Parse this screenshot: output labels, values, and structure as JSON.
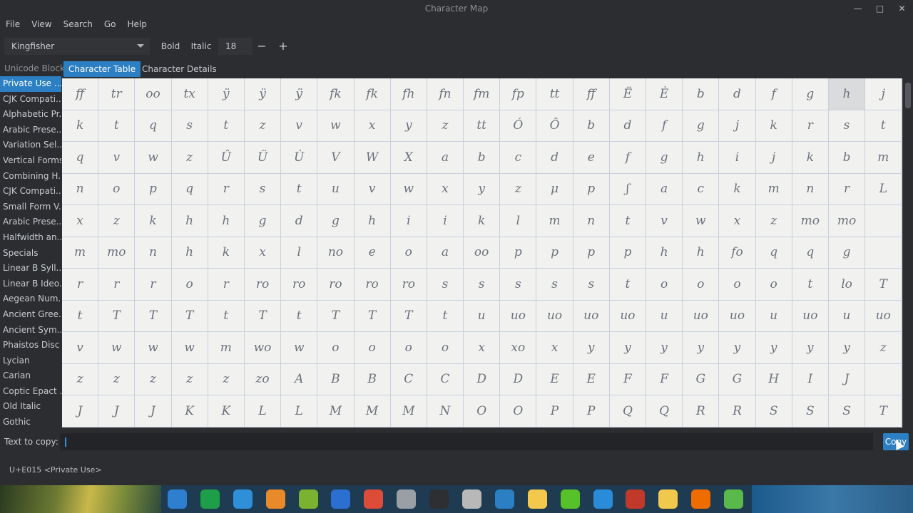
{
  "window": {
    "title": "Character Map"
  },
  "menu": [
    "File",
    "View",
    "Search",
    "Go",
    "Help"
  ],
  "toolbar": {
    "font": "Kingfisher",
    "bold": "Bold",
    "italic": "Italic",
    "size": "18",
    "minus": "−",
    "plus": "+"
  },
  "tabs": {
    "unicode_block_label": "Unicode Block",
    "character_table": "Character Table",
    "character_details": "Character Details"
  },
  "sidebar": [
    "Private Use ...",
    "CJK Compati...",
    "Alphabetic Pr...",
    "Arabic Prese...",
    "Variation Sel...",
    "Vertical Forms",
    "Combining H...",
    "CJK Compati...",
    "Small Form V...",
    "Arabic Prese...",
    "Halfwidth an...",
    "Specials",
    "Linear B Syll...",
    "Linear B Ideo...",
    "Aegean Num...",
    "Ancient Gree...",
    "Ancient Sym...",
    "Phaistos Disc",
    "Lycian",
    "Carian",
    "Coptic Epact ...",
    "Old Italic",
    "Gothic"
  ],
  "grid_rows": [
    [
      "ff",
      "tr",
      "oo",
      "tx",
      "ÿ",
      "ÿ",
      "ÿ",
      "fk",
      "fk",
      "fh",
      "fn",
      "fm",
      "fp",
      "tt",
      "ff",
      "Ë",
      "È",
      "b",
      "d",
      "f",
      "g",
      "h",
      "j"
    ],
    [
      "k",
      "t",
      "q",
      "s",
      "t",
      "z",
      "v",
      "w",
      "x",
      "y",
      "z",
      "tt",
      "Ó",
      "Ô",
      "b",
      "d",
      "f",
      "g",
      "j",
      "k",
      "r",
      "s",
      "t"
    ],
    [
      "q",
      "v",
      "w",
      "z",
      "Û",
      "Ü",
      "Ù",
      "V",
      "W",
      "X",
      "a",
      "b",
      "c",
      "d",
      "e",
      "f",
      "g",
      "h",
      "i",
      "j",
      "k",
      "b",
      "m"
    ],
    [
      "n",
      "o",
      "p",
      "q",
      "r",
      "s",
      "t",
      "u",
      "v",
      "w",
      "x",
      "y",
      "z",
      "μ",
      "p",
      "ʃ",
      "a",
      "c",
      "k",
      "m",
      "n",
      "r",
      "L"
    ],
    [
      "x",
      "z",
      "k",
      "h",
      "h",
      "g",
      "d",
      "g",
      "h",
      "i",
      "i",
      "k",
      "l",
      "m",
      "n",
      "t",
      "v",
      "w",
      "x",
      "z",
      "mo",
      "mo",
      ""
    ],
    [
      "m",
      "mo",
      "n",
      "h",
      "k",
      "x",
      "l",
      "no",
      "e",
      "o",
      "a",
      "oo",
      "p",
      "p",
      "p",
      "p",
      "h",
      "h",
      "fo",
      "q",
      "q",
      "g",
      ""
    ],
    [
      "r",
      "r",
      "r",
      "o",
      "r",
      "ro",
      "ro",
      "ro",
      "ro",
      "ro",
      "s",
      "s",
      "s",
      "s",
      "s",
      "t",
      "o",
      "o",
      "o",
      "o",
      "t",
      "lo",
      "T"
    ],
    [
      "t",
      "T",
      "T",
      "T",
      "t",
      "T",
      "t",
      "T",
      "T",
      "T",
      "t",
      "u",
      "uo",
      "uo",
      "uo",
      "uo",
      "u",
      "uo",
      "uo",
      "u",
      "uo",
      "u",
      "uo"
    ],
    [
      "v",
      "w",
      "w",
      "w",
      "m",
      "wo",
      "w",
      "o",
      "o",
      "o",
      "o",
      "x",
      "xo",
      "x",
      "y",
      "y",
      "y",
      "y",
      "y",
      "y",
      "y",
      "y",
      "z"
    ],
    [
      "z",
      "z",
      "z",
      "z",
      "z",
      "zo",
      "A",
      "B",
      "B",
      "C",
      "C",
      "D",
      "D",
      "E",
      "E",
      "F",
      "F",
      "G",
      "G",
      "H",
      "I",
      "J",
      ""
    ],
    [
      "J",
      "J",
      "J",
      "K",
      "K",
      "L",
      "L",
      "M",
      "M",
      "M",
      "N",
      "O",
      "O",
      "P",
      "P",
      "Q",
      "Q",
      "R",
      "R",
      "S",
      "S",
      "S",
      "T"
    ]
  ],
  "highlighted_cell": {
    "row": 0,
    "col": 21
  },
  "copy": {
    "label": "Text to copy:",
    "value": "",
    "button": "Copy"
  },
  "status": "U+E015 <Private Use>",
  "taskbar_icons": [
    "menu-icon",
    "spreadsheet-icon",
    "store-icon",
    "files-icon",
    "music-icon",
    "video-icon",
    "chrome-icon",
    "settings-icon",
    "shell-icon",
    "archive-icon",
    "screenshot-icon",
    "clock-icon",
    "power-icon",
    "wifi-icon",
    "pdf-icon",
    "clock-20-icon",
    "vlc-icon",
    "trash-icon"
  ]
}
